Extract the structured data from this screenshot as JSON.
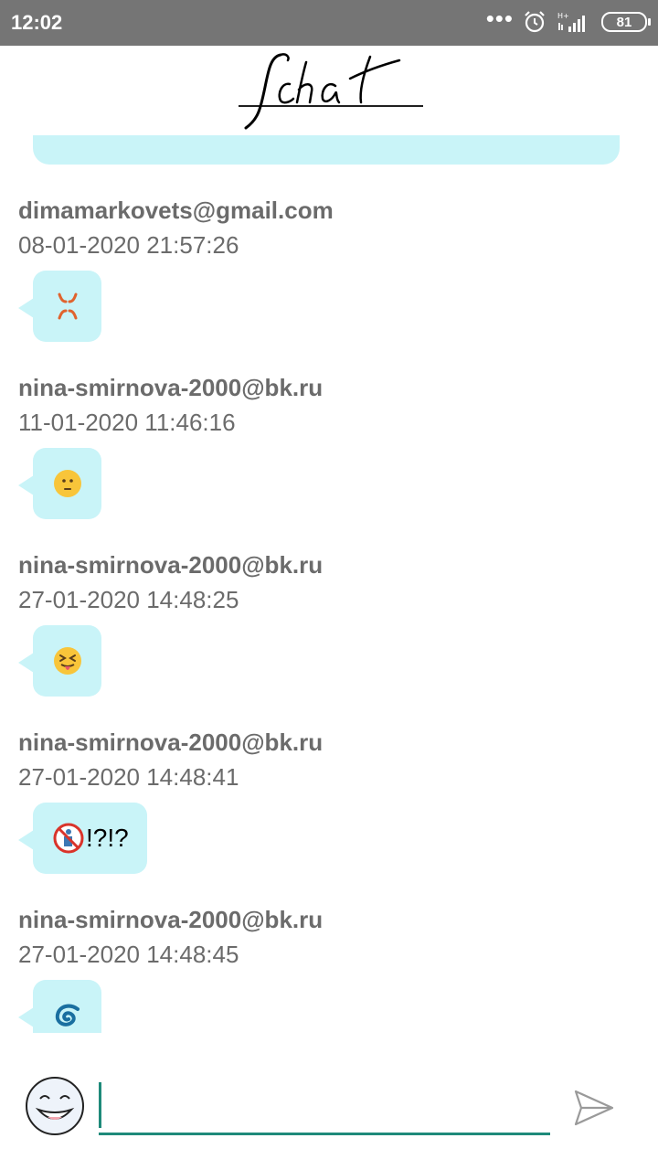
{
  "status_bar": {
    "time": "12:02",
    "dots": "•••",
    "network_label": "H+",
    "battery": "81"
  },
  "header": {
    "logo_text": "Jchat"
  },
  "messages": [
    {
      "sender": "dimamarkovets@gmail.com",
      "timestamp": "08-01-2020 21:57:26",
      "content_icon": "anger-symbol-icon"
    },
    {
      "sender": "nina-smirnova-2000@bk.ru",
      "timestamp": "11-01-2020 11:46:16",
      "content_icon": "face-emoji-icon"
    },
    {
      "sender": "nina-smirnova-2000@bk.ru",
      "timestamp": "27-01-2020 14:48:25",
      "content_icon": "squinting-tongue-face-icon"
    },
    {
      "sender": "nina-smirnova-2000@bk.ru",
      "timestamp": "27-01-2020 14:48:41",
      "content_prefix": "",
      "content_icon": "no-littering-icon",
      "content_suffix": "!?!?"
    },
    {
      "sender": "nina-smirnova-2000@bk.ru",
      "timestamp": "27-01-2020 14:48:45",
      "content_icon": "cyclone-icon"
    }
  ],
  "input": {
    "value": "",
    "placeholder": ""
  },
  "colors": {
    "status_bar": "#757575",
    "bubble": "#c9f4f8",
    "accent": "#1e8a7a",
    "text_secondary": "#6b6b6b"
  }
}
